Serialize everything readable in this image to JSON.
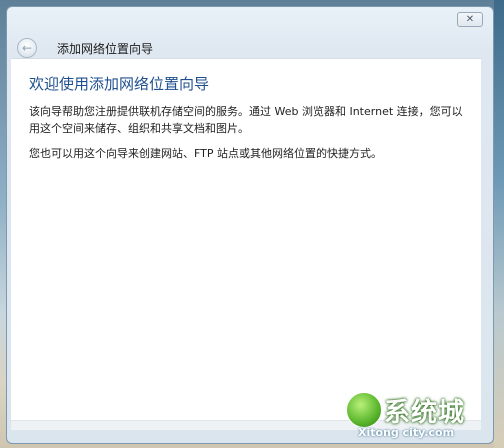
{
  "window": {
    "title": "添加网络位置向导",
    "close_icon": "✕",
    "back_icon": "←"
  },
  "content": {
    "heading": "欢迎使用添加网络位置向导",
    "paragraph1": "该向导帮助您注册提供联机存储空间的服务。通过 Web 浏览器和 Internet 连接，您可以用这个空间来储存、组织和共享文档和图片。",
    "paragraph2": "您也可以用这个向导来创建网站、FTP 站点或其他网络位置的快捷方式。"
  },
  "watermark": {
    "text": "系统城",
    "domain": "Xitong city.com"
  }
}
